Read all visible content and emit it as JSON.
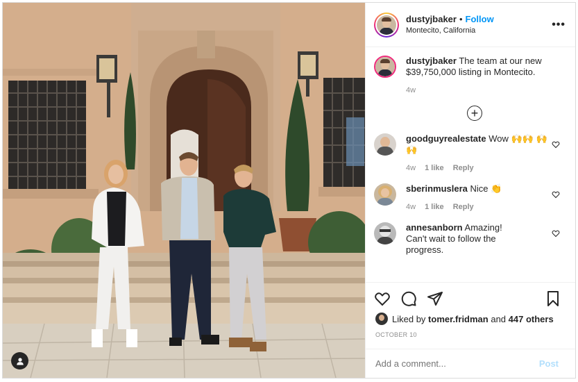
{
  "post": {
    "author": "dustyjbaker",
    "separator": "•",
    "follow_label": "Follow",
    "location": "Montecito, California",
    "more_label": "•••",
    "caption": {
      "username": "dustyjbaker",
      "text": " The team at our new $39,750,000 listing in Montecito.",
      "age": "4w"
    },
    "load_more_icon": "plus-circle-icon",
    "comments": [
      {
        "username": "goodguyrealestate",
        "text": " Wow 🙌🙌 🙌🙌",
        "age": "4w",
        "likes": "1 like",
        "reply": "Reply"
      },
      {
        "username": "sberinmuslera",
        "text": " Nice 👏",
        "age": "4w",
        "likes": "1 like",
        "reply": "Reply"
      },
      {
        "username": "annesanborn",
        "text": " Amazing! Can't wait to follow the progress.",
        "age": "",
        "likes": "",
        "reply": ""
      }
    ],
    "actions": {
      "like_icon": "heart-icon",
      "comment_icon": "comment-icon",
      "share_icon": "share-icon",
      "save_icon": "bookmark-icon"
    },
    "liked_by": {
      "prefix": "Liked by ",
      "user": "tomer.fridman",
      "mid": " and ",
      "others": "447 others"
    },
    "date": "OCTOBER 10",
    "add_comment_placeholder": "Add a comment...",
    "post_label": "Post",
    "colors": {
      "link": "#0095f6",
      "post_disabled": "#b2dffc",
      "muted": "#8e8e8e"
    }
  }
}
